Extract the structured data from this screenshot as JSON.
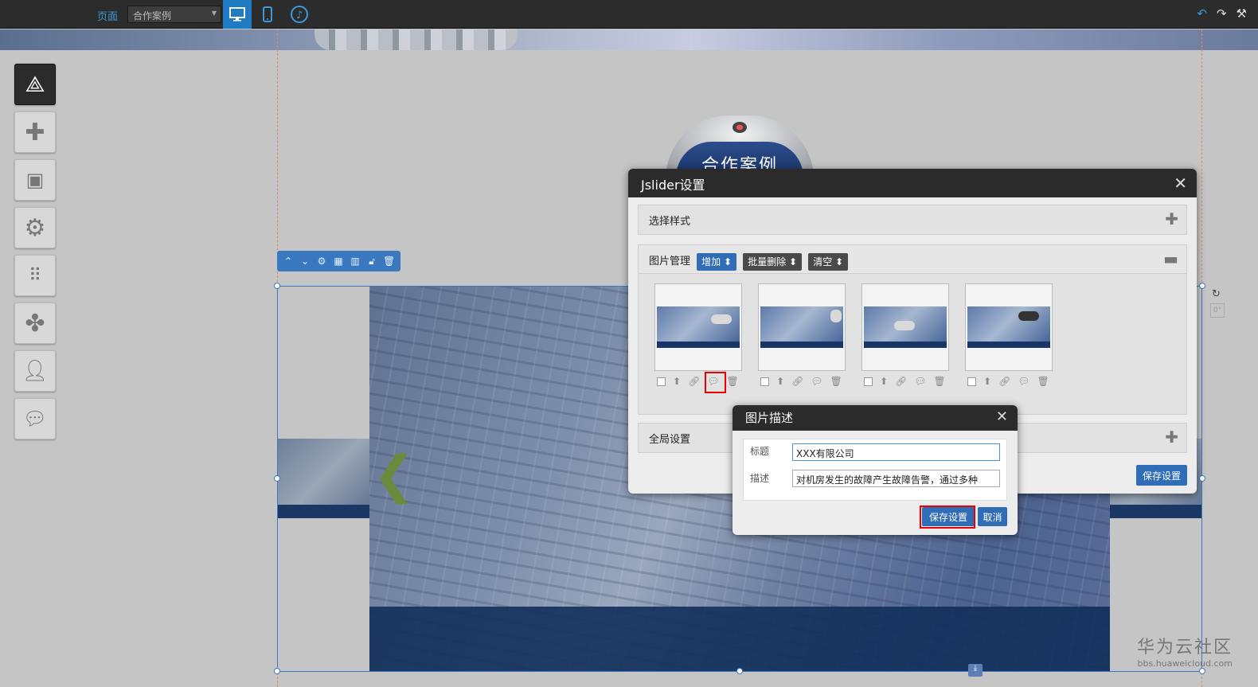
{
  "topbar": {
    "page_label": "页面",
    "page_select_value": "合作案例",
    "accent": "#1f7cc3"
  },
  "logo": {
    "text": "合作案例"
  },
  "main_dialog": {
    "title": "Jslider设置",
    "section_style": "选择样式",
    "section_images": "图片管理",
    "add_label": "增加",
    "batch_delete_label": "批量删除",
    "clear_label": "清空",
    "section_global": "全局设置",
    "save_label": "保存设置",
    "thumbnails": [
      {
        "name": "image-1"
      },
      {
        "name": "image-2"
      },
      {
        "name": "image-3"
      },
      {
        "name": "image-4"
      }
    ]
  },
  "desc_dialog": {
    "title": "图片描述",
    "title_label": "标题",
    "title_value": "XXX有限公司",
    "desc_label": "描述",
    "desc_value": "对机房发生的故障产生故障告警，通过多种",
    "save_label": "保存设置",
    "cancel_label": "取消"
  },
  "watermark": {
    "brand": "华为云社区",
    "url": "bbs.huaweicloud.com"
  }
}
